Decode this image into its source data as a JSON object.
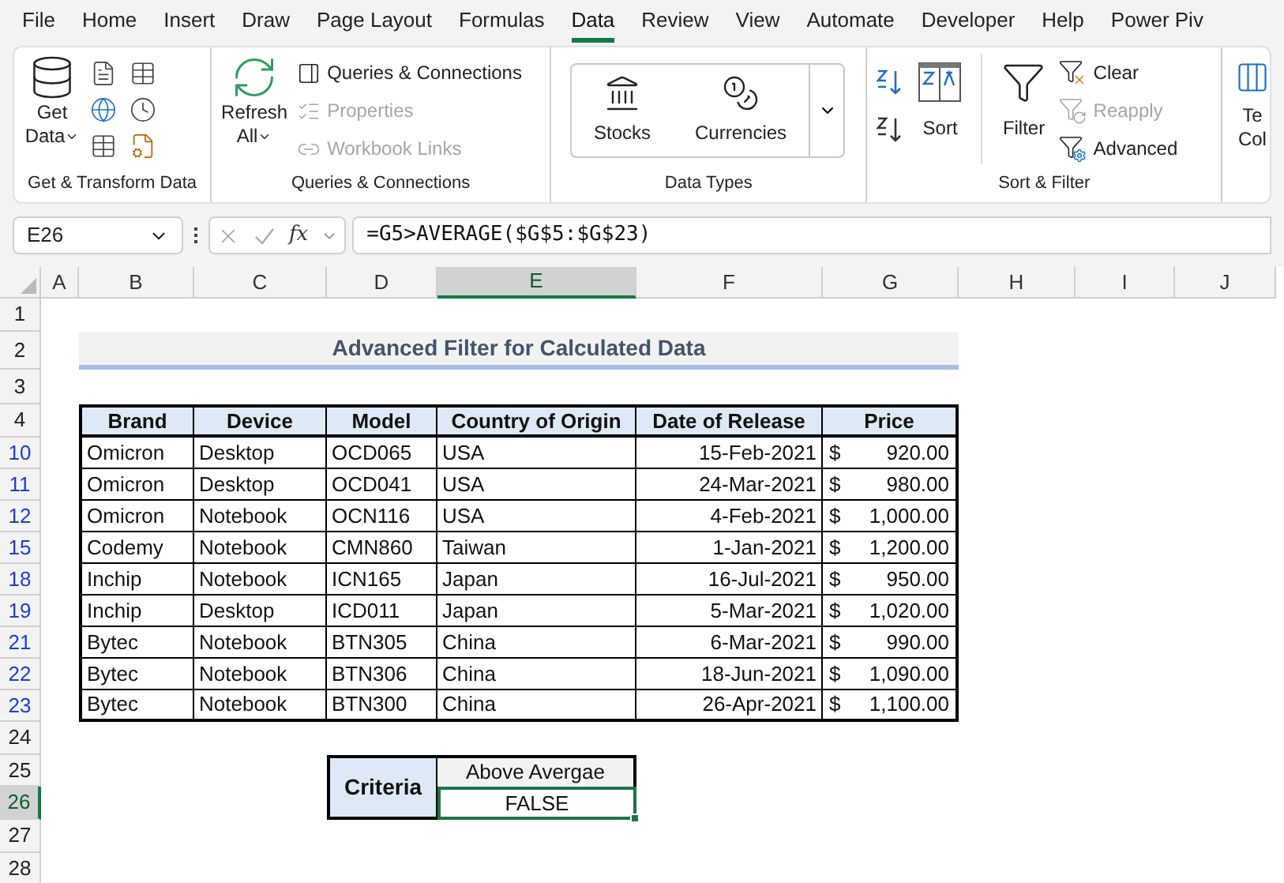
{
  "menu_tabs": [
    {
      "label": "File",
      "selected": false
    },
    {
      "label": "Home",
      "selected": false
    },
    {
      "label": "Insert",
      "selected": false
    },
    {
      "label": "Draw",
      "selected": false
    },
    {
      "label": "Page Layout",
      "selected": false
    },
    {
      "label": "Formulas",
      "selected": false
    },
    {
      "label": "Data",
      "selected": true
    },
    {
      "label": "Review",
      "selected": false
    },
    {
      "label": "View",
      "selected": false
    },
    {
      "label": "Automate",
      "selected": false
    },
    {
      "label": "Developer",
      "selected": false
    },
    {
      "label": "Help",
      "selected": false
    },
    {
      "label": "Power Piv",
      "selected": false
    }
  ],
  "ribbon": {
    "get_transform": {
      "title": "Get & Transform Data",
      "get_data": [
        "Get",
        "Data"
      ]
    },
    "queries": {
      "title": "Queries & Connections",
      "refresh": [
        "Refresh",
        "All"
      ],
      "commands": [
        {
          "label": "Queries & Connections",
          "disabled": false
        },
        {
          "label": "Properties",
          "disabled": true
        },
        {
          "label": "Workbook Links",
          "disabled": true
        }
      ]
    },
    "data_types": {
      "title": "Data Types",
      "types": [
        "Stocks",
        "Currencies"
      ]
    },
    "sort_filter": {
      "title": "Sort & Filter",
      "sort": "Sort",
      "filter": "Filter",
      "commands": [
        {
          "label": "Clear",
          "disabled": false
        },
        {
          "label": "Reapply",
          "disabled": true
        },
        {
          "label": "Advanced",
          "disabled": false
        }
      ]
    },
    "text_to_columns": [
      "Te",
      "Col"
    ]
  },
  "formula_bar": {
    "name_box": "E26",
    "fx": "fx",
    "formula": "=G5>AVERAGE($G$5:$G$23)"
  },
  "columns": [
    {
      "label": "A",
      "selected": false
    },
    {
      "label": "B",
      "selected": false
    },
    {
      "label": "C",
      "selected": false
    },
    {
      "label": "D",
      "selected": false
    },
    {
      "label": "E",
      "selected": true
    },
    {
      "label": "F",
      "selected": false
    },
    {
      "label": "G",
      "selected": false
    },
    {
      "label": "H",
      "selected": false
    },
    {
      "label": "I",
      "selected": false
    },
    {
      "label": "J",
      "selected": false
    }
  ],
  "row_headers": [
    {
      "label": "1",
      "selected": false,
      "filtered": false
    },
    {
      "label": "2",
      "selected": false,
      "filtered": false
    },
    {
      "label": "3",
      "selected": false,
      "filtered": false
    },
    {
      "label": "4",
      "selected": false,
      "filtered": false
    },
    {
      "label": "10",
      "selected": false,
      "filtered": true
    },
    {
      "label": "11",
      "selected": false,
      "filtered": true
    },
    {
      "label": "12",
      "selected": false,
      "filtered": true
    },
    {
      "label": "15",
      "selected": false,
      "filtered": true
    },
    {
      "label": "18",
      "selected": false,
      "filtered": true
    },
    {
      "label": "19",
      "selected": false,
      "filtered": true
    },
    {
      "label": "21",
      "selected": false,
      "filtered": true
    },
    {
      "label": "22",
      "selected": false,
      "filtered": true
    },
    {
      "label": "23",
      "selected": false,
      "filtered": true
    },
    {
      "label": "24",
      "selected": false,
      "filtered": false
    },
    {
      "label": "25",
      "selected": false,
      "filtered": false
    },
    {
      "label": "26",
      "selected": true,
      "filtered": false
    },
    {
      "label": "27",
      "selected": false,
      "filtered": false
    },
    {
      "label": "28",
      "selected": false,
      "filtered": false
    }
  ],
  "sheet_title": "Advanced Filter for Calculated Data",
  "table": {
    "columns": [
      "Brand",
      "Device",
      "Model",
      "Country of Origin",
      "Date of Release",
      "Price"
    ],
    "rows": [
      {
        "cells": [
          "Omicron",
          "Desktop",
          "OCD065",
          "USA",
          "15-Feb-2021"
        ],
        "currency": "$",
        "amount": "920.00"
      },
      {
        "cells": [
          "Omicron",
          "Desktop",
          "OCD041",
          "USA",
          "24-Mar-2021"
        ],
        "currency": "$",
        "amount": "980.00"
      },
      {
        "cells": [
          "Omicron",
          "Notebook",
          "OCN116",
          "USA",
          "4-Feb-2021"
        ],
        "currency": "$",
        "amount": "1,000.00"
      },
      {
        "cells": [
          "Codemy",
          "Notebook",
          "CMN860",
          "Taiwan",
          "1-Jan-2021"
        ],
        "currency": "$",
        "amount": "1,200.00"
      },
      {
        "cells": [
          "Inchip",
          "Notebook",
          "ICN165",
          "Japan",
          "16-Jul-2021"
        ],
        "currency": "$",
        "amount": "950.00"
      },
      {
        "cells": [
          "Inchip",
          "Desktop",
          "ICD011",
          "Japan",
          "5-Mar-2021"
        ],
        "currency": "$",
        "amount": "1,020.00"
      },
      {
        "cells": [
          "Bytec",
          "Notebook",
          "BTN305",
          "China",
          "6-Mar-2021"
        ],
        "currency": "$",
        "amount": "990.00"
      },
      {
        "cells": [
          "Bytec",
          "Notebook",
          "BTN306",
          "China",
          "18-Jun-2021"
        ],
        "currency": "$",
        "amount": "1,090.00"
      },
      {
        "cells": [
          "Bytec",
          "Notebook",
          "BTN300",
          "China",
          "26-Apr-2021"
        ],
        "currency": "$",
        "amount": "1,100.00"
      }
    ]
  },
  "criteria": {
    "label": "Criteria",
    "header": "Above Avergae",
    "value": "FALSE",
    "selected": true
  }
}
